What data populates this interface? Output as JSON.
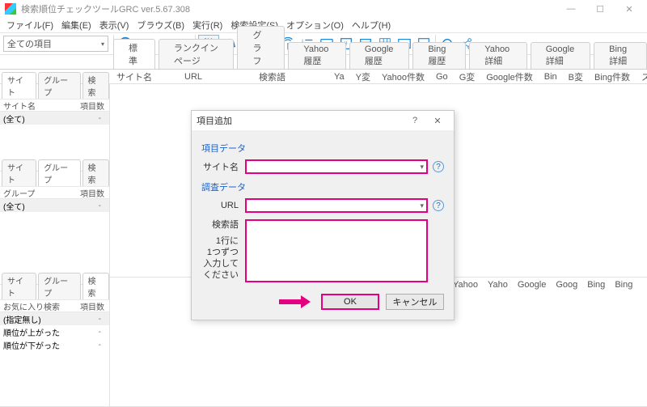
{
  "window": {
    "title": "検索順位チェックツールGRC  ver.5.67.308",
    "controls": {
      "min": "—",
      "max": "☐",
      "close": "✕"
    }
  },
  "menu": [
    "ファイル(F)",
    "編集(E)",
    "表示(V)",
    "ブラウズ(B)",
    "実行(R)",
    "検索設定(S)",
    "オプション(O)",
    "ヘルプ(H)"
  ],
  "filter_combo": {
    "value": "全ての項目"
  },
  "toolbar_all": "ALL",
  "main_tabs": [
    "標準",
    "ランクインページ",
    "グラフ",
    "Yahoo履歴",
    "Google履歴",
    "Bing履歴",
    "Yahoo詳細",
    "Google詳細",
    "Bing詳細"
  ],
  "main_cols": [
    "サイト名",
    "URL",
    "検索語",
    "Ya",
    "Y変",
    "Yahoo件数",
    "Go",
    "G変",
    "Google件数",
    "Bin",
    "B変",
    "Bing件数",
    "ステータス"
  ],
  "left": {
    "p1": {
      "tabs": [
        "サイト",
        "グループ",
        "検索"
      ],
      "head": {
        "c1": "サイト名",
        "c2": "項目数"
      },
      "rows": [
        {
          "c1": "(全て)",
          "c2": "-",
          "sel": true
        }
      ]
    },
    "p2": {
      "tabs": [
        "サイト",
        "グループ",
        "検索"
      ],
      "head": {
        "c1": "グループ",
        "c2": "項目数"
      },
      "rows": [
        {
          "c1": "(全て)",
          "c2": "-",
          "sel": true
        }
      ]
    },
    "p3": {
      "tabs": [
        "サイト",
        "グループ",
        "検索"
      ],
      "head": {
        "c1": "お気に入り検索",
        "c2": "項目数"
      },
      "rows": [
        {
          "c1": "(指定無し)",
          "c2": "-",
          "sel": true
        },
        {
          "c1": "順位が上がった",
          "c2": "-"
        },
        {
          "c1": "順位が下がった",
          "c2": "-"
        }
      ]
    }
  },
  "secondary_cols": [
    "Yahoo",
    "Yaho",
    "Google",
    "Goog",
    "Bing",
    "Bing"
  ],
  "dialog": {
    "title": "項目追加",
    "g1": "項目データ",
    "g2": "調査データ",
    "site_label": "サイト名",
    "url_label": "URL",
    "kw_label": "検索語",
    "kw_hint": [
      "1行に",
      "1つずつ",
      "入力して",
      "ください"
    ],
    "ok": "OK",
    "cancel": "キャンセル",
    "help": "?",
    "close": "✕"
  }
}
